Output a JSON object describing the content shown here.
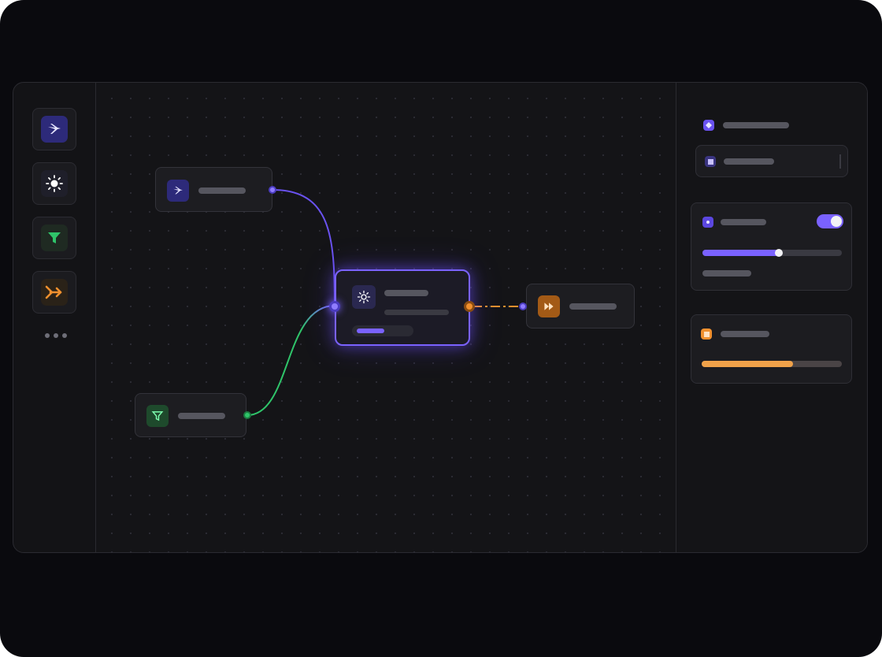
{
  "colors": {
    "accent": "#7a62ff",
    "success": "#2fc46a",
    "warning": "#f0902e",
    "background": "#0a0a0e"
  },
  "sidebar": {
    "tools": [
      {
        "icon": "plane-icon",
        "color": "#2d2a7a"
      },
      {
        "icon": "sun-icon",
        "color": "#1f1f2a"
      },
      {
        "icon": "funnel-icon",
        "color": "#1f2a22"
      },
      {
        "icon": "arrow-forward-icon",
        "color": "#2a2218"
      }
    ],
    "more_icon": "ellipsis-icon"
  },
  "canvas": {
    "nodes": [
      {
        "id": "source",
        "icon": "plane-icon"
      },
      {
        "id": "filter",
        "icon": "funnel-icon"
      },
      {
        "id": "process",
        "icon": "sun-icon",
        "selected": true,
        "progress": 0.55
      },
      {
        "id": "output",
        "icon": "skip-forward-icon"
      }
    ]
  },
  "inspector": {
    "header_icon": "diamond-icon",
    "field_icon": "square-icon",
    "settings": {
      "icon": "dot-icon",
      "toggle_on": true,
      "slider_value": 0.55
    },
    "status": {
      "icon": "square-icon",
      "progress": 0.65
    }
  }
}
